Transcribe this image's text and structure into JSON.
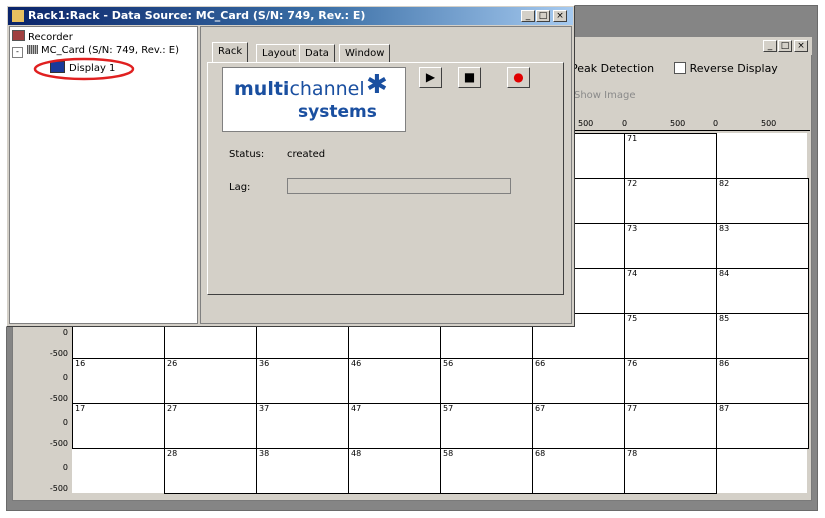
{
  "background_window": {
    "options": {
      "peak_detection": "Peak Detection",
      "reverse_display": "Reverse Display",
      "show_image": "Show Image"
    },
    "top_scale": [
      "500",
      "0",
      "500",
      "0",
      "500"
    ],
    "y_scale": {
      "zero": "0",
      "neg": "-500"
    },
    "grid_rows": [
      [
        "",
        "",
        "",
        "",
        "",
        "",
        "71",
        ""
      ],
      [
        "",
        "",
        "",
        "",
        "",
        "",
        "72",
        "82"
      ],
      [
        "",
        "",
        "",
        "",
        "",
        "",
        "73",
        "83"
      ],
      [
        "",
        "",
        "",
        "",
        "",
        "",
        "74",
        "84"
      ],
      [
        "",
        "",
        "",
        "",
        "",
        "",
        "75",
        "85"
      ],
      [
        "16",
        "26",
        "36",
        "46",
        "56",
        "66",
        "76",
        "86"
      ],
      [
        "17",
        "27",
        "37",
        "47",
        "57",
        "67",
        "77",
        "87"
      ],
      [
        "",
        "28",
        "38",
        "48",
        "58",
        "68",
        "78",
        ""
      ]
    ]
  },
  "rack_window": {
    "title": "Rack1:Rack - Data Source: MC_Card (S/N: 749, Rev.: E)",
    "window_buttons": [
      "_",
      "□",
      "×"
    ],
    "tree": {
      "root": "Recorder",
      "card": "MC_Card (S/N: 749, Rev.: E)",
      "display": "Display 1"
    },
    "tabs": [
      "Rack",
      "Layout",
      "Data",
      "Window"
    ],
    "logo": {
      "line1_bold": "multi",
      "line1_light": "channel",
      "line2": "systems"
    },
    "controls": {
      "play": "▶",
      "stop": "■",
      "record": "●"
    },
    "status_label": "Status:",
    "status_value": "created",
    "lag_label": "Lag:"
  },
  "colors": {
    "highlight_circle": "#e02020",
    "record_dot": "#e00000",
    "logo_blue": "#1a4fa0"
  }
}
